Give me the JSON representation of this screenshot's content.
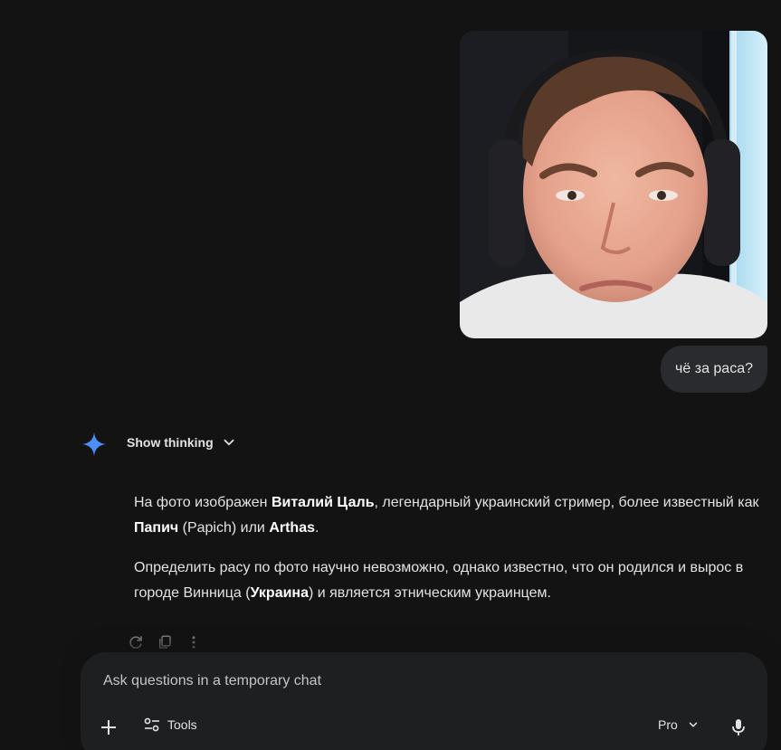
{
  "photo": {
    "icon": "uploaded-photo",
    "description_hidden": ""
  },
  "user_message": {
    "text": "чё за раса?"
  },
  "response": {
    "thinking_label": "Show thinking",
    "p1_a": "На фото изображен ",
    "p1_b": "Виталий Цаль",
    "p1_c": ", легендарный украинский стример, более известный как ",
    "p1_d": "Папич",
    "p1_e": " (Papich) или ",
    "p1_f": "Arthas",
    "p1_g": ".",
    "p2_a": "Определить расу по фото научно невозможно, однако известно, что он родился и вырос в городе Винница (",
    "p2_b": "Украина",
    "p2_c": ") и является этническим украинцем."
  },
  "composer": {
    "placeholder": "Ask questions in a temporary chat",
    "tools_label": "Tools",
    "model_label": "Pro"
  },
  "colors": {
    "background": "#131314",
    "bubble": "#2a2b2e",
    "composer": "#1e1f20",
    "spark": "#4c8df6"
  }
}
